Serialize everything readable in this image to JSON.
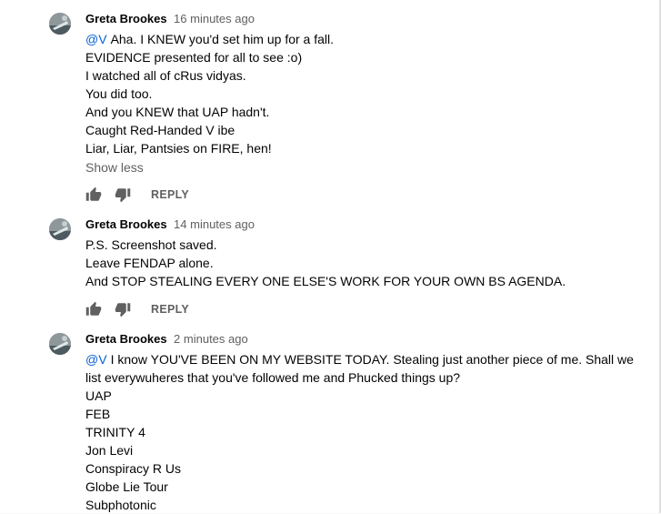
{
  "comments": [
    {
      "author": "Greta Brookes",
      "time": "16 minutes ago",
      "mention": "@V",
      "lines": [
        "Aha. I KNEW you'd set him up for a fall.",
        "EVIDENCE presented for all to see :o)",
        "I watched all of cRus vidyas.",
        "You did too.",
        "And you KNEW that UAP hadn't.",
        "Caught Red-Handed V ibe",
        "Liar, Liar, Pantsies on FIRE, hen!"
      ],
      "show_less": "Show less",
      "reply": "REPLY"
    },
    {
      "author": "Greta Brookes",
      "time": "14 minutes ago",
      "lines": [
        "P.S. Screenshot saved.",
        "Leave FENDAP alone.",
        "And STOP STEALING EVERY ONE ELSE'S WORK FOR YOUR OWN BS AGENDA."
      ],
      "reply": "REPLY"
    },
    {
      "author": "Greta Brookes",
      "time": "2 minutes ago",
      "mention": "@V",
      "lines": [
        "I  know YOU'VE BEEN ON MY WEBSITE TODAY. Stealing just another piece of me. Shall we",
        "list everywuheres that you've followed me and Phucked things up?",
        "UAP",
        "FEB",
        "TRINITY 4",
        "Jon Levi",
        "Conspiracy R Us",
        "Globe Lie Tour",
        "Subphotonic"
      ]
    }
  ],
  "icons": {
    "like": "thumbs-up-icon",
    "dislike": "thumbs-down-icon"
  },
  "colors": {
    "mention": "#065fd4",
    "secondary_text": "#606060",
    "primary_text": "#030303"
  }
}
